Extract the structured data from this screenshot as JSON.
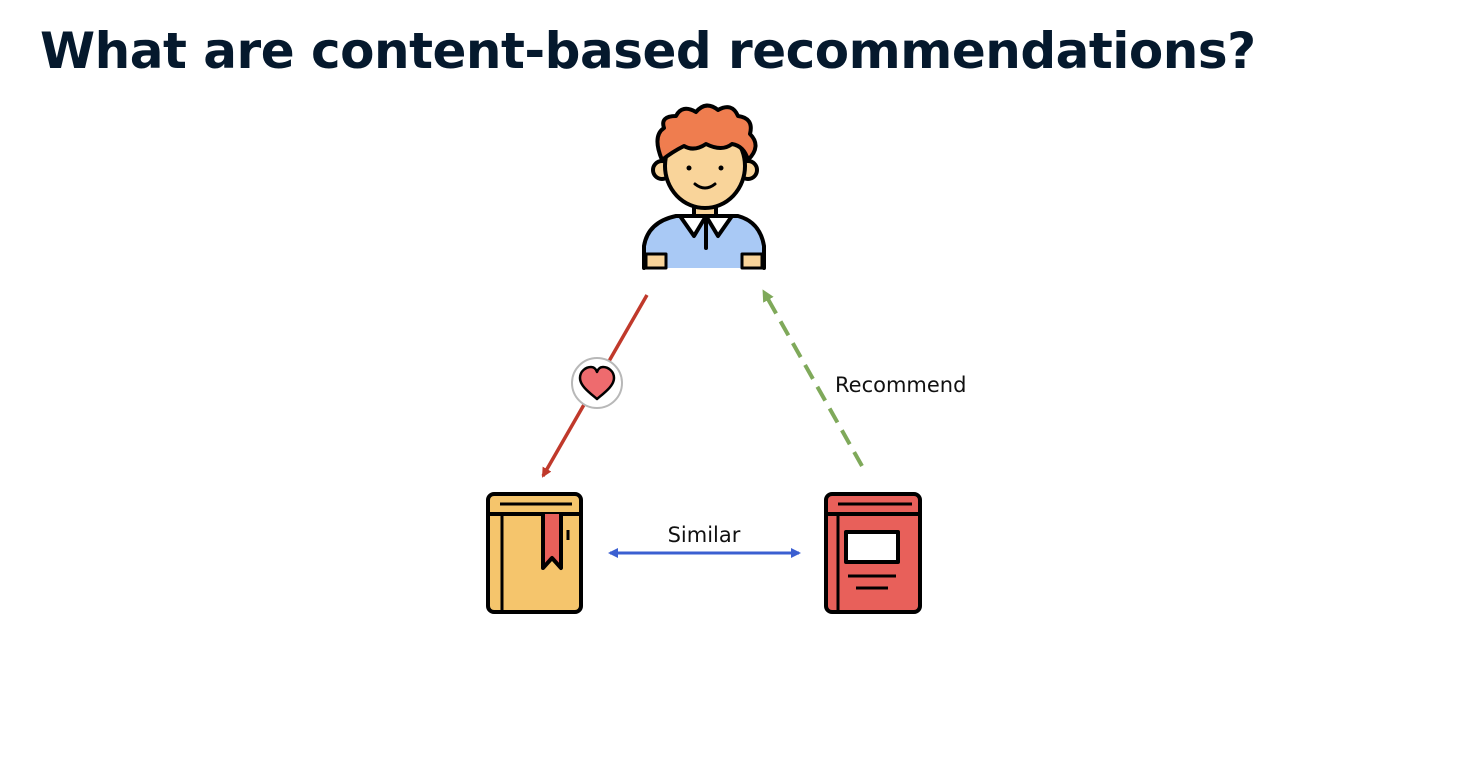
{
  "title": "What are content-based recommendations?",
  "diagram": {
    "nodes": [
      {
        "id": "user",
        "icon": "user-icon"
      },
      {
        "id": "liked_item",
        "icon": "yellow-book-icon"
      },
      {
        "id": "recommended_item",
        "icon": "red-book-icon"
      }
    ],
    "edges": [
      {
        "from": "user",
        "to": "liked_item",
        "style": "solid",
        "color": "#c0392b",
        "badge": "heart-icon"
      },
      {
        "from": "liked_item",
        "to": "recommended_item",
        "style": "solid",
        "direction": "both",
        "color": "#3b5fd1",
        "label": "Similar"
      },
      {
        "from": "recommended_item",
        "to": "user",
        "style": "dashed",
        "color": "#7fa95a",
        "label": "Recommend"
      }
    ]
  },
  "labels": {
    "similar": "Similar",
    "recommend": "Recommend"
  },
  "colors": {
    "title": "#05192d",
    "like_arrow": "#c0392b",
    "similar_arrow": "#3b5fd1",
    "recommend_arrow": "#7fa95a",
    "heart": "#ee6b6e",
    "yellow_book": "#f5c56c",
    "red_book": "#e8605a",
    "user_shirt": "#a9c9f5",
    "user_hair": "#ef7d4f",
    "user_skin": "#f9d49a"
  }
}
